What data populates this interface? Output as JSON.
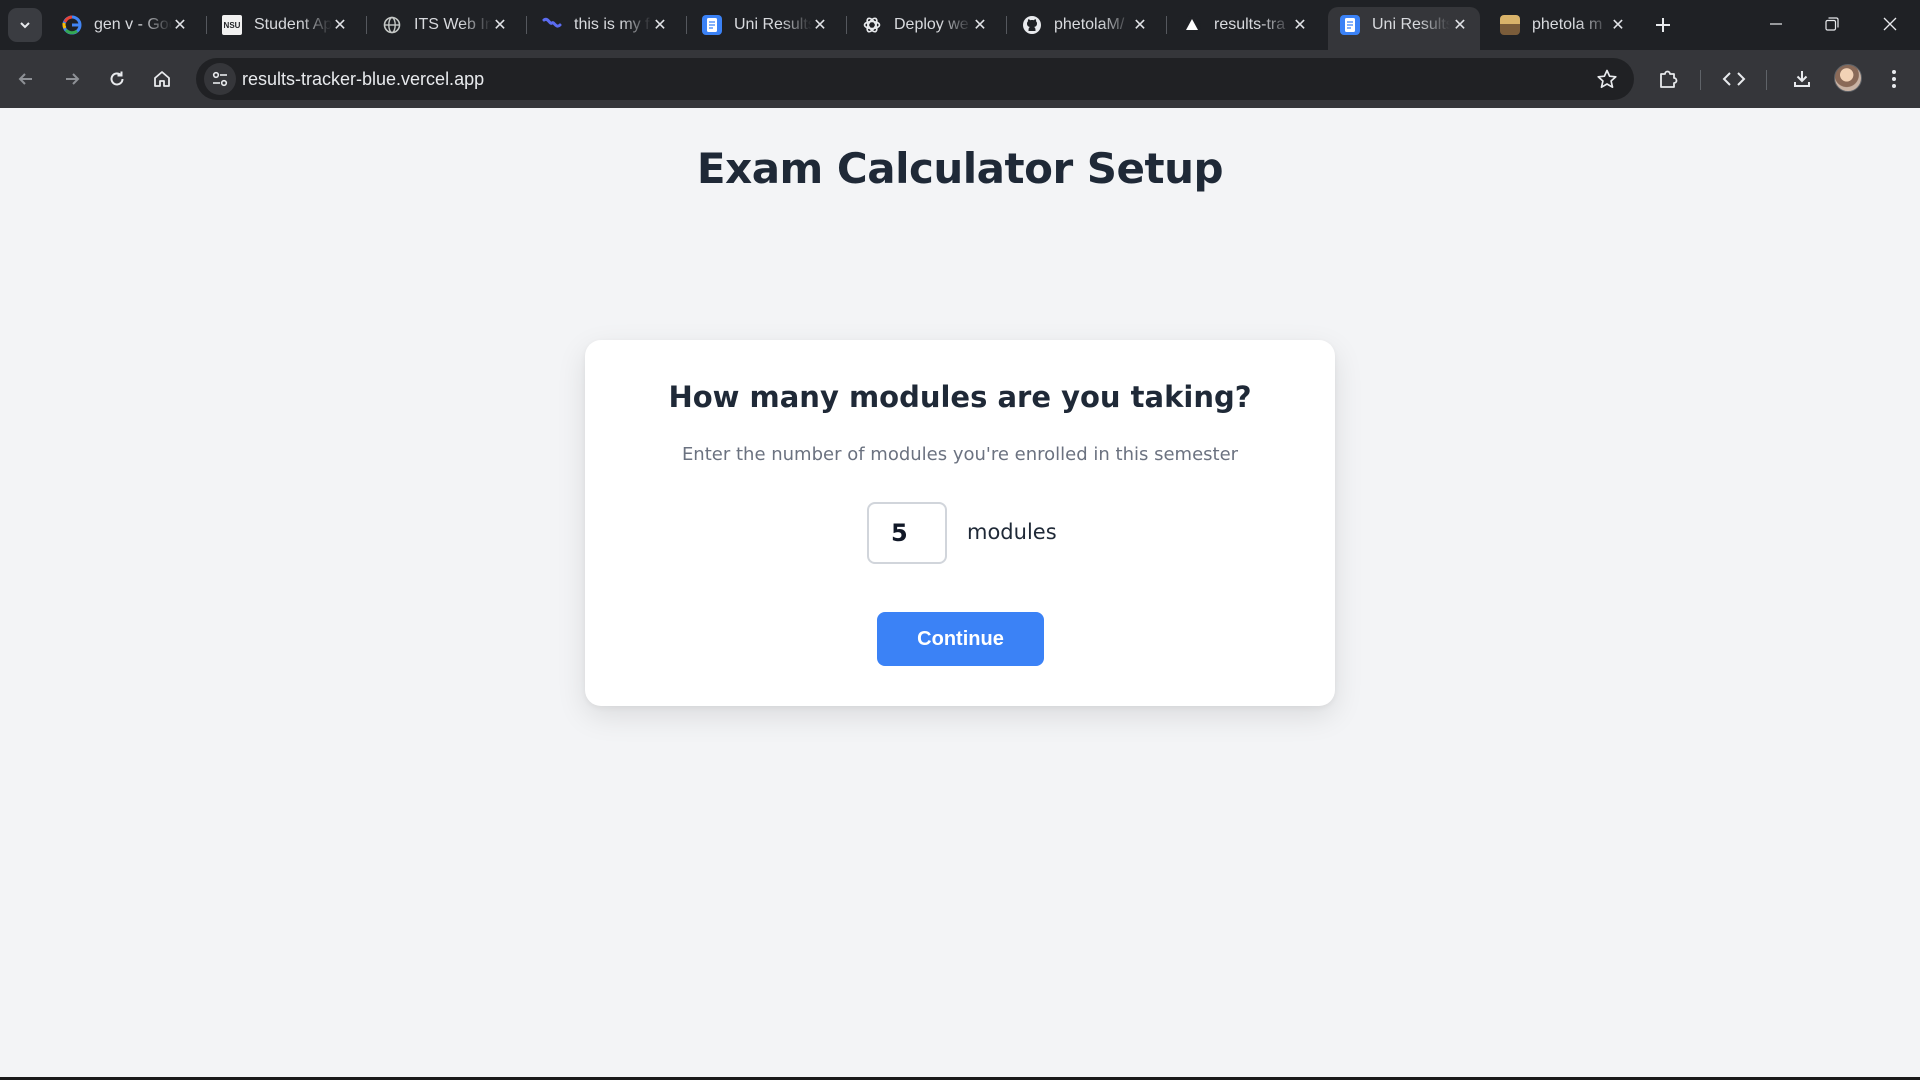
{
  "browser": {
    "tabs": [
      {
        "title": "gen v - Google Search",
        "icon": "google-icon"
      },
      {
        "title": "Student Ap",
        "icon": "university-icon",
        "favicon_text": "NSU"
      },
      {
        "title": "ITS Web In",
        "icon": "globe-icon"
      },
      {
        "title": "this is my f",
        "icon": "chat-icon"
      },
      {
        "title": "Uni Results",
        "icon": "document-icon"
      },
      {
        "title": "Deploy we",
        "icon": "openai-icon"
      },
      {
        "title": "phetolaM/",
        "icon": "github-icon"
      },
      {
        "title": "results-tra",
        "icon": "vercel-icon"
      },
      {
        "title": "Uni Results",
        "icon": "document-icon",
        "active": true
      },
      {
        "title": "phetola m",
        "icon": "image-icon"
      }
    ],
    "url": "results-tracker-blue.vercel.app"
  },
  "page": {
    "title": "Exam Calculator Setup",
    "card": {
      "heading": "How many modules are you taking?",
      "description": "Enter the number of modules you're enrolled in this semester",
      "input_value": "5",
      "input_suffix": "modules",
      "continue_label": "Continue"
    }
  },
  "colors": {
    "accent": "#3b82f6",
    "background": "#f3f4f6",
    "heading": "#1f2937",
    "muted_text": "#6b7280"
  }
}
